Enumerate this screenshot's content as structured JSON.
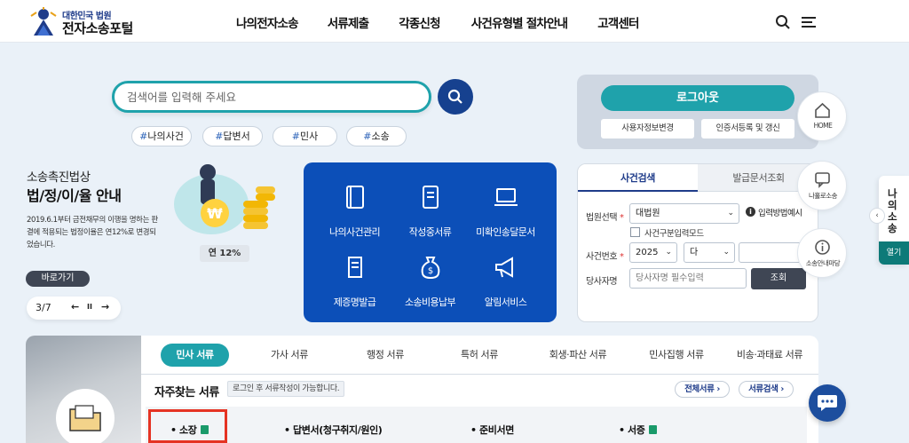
{
  "header": {
    "logo_small": "대한민국 법원",
    "logo_big": "전자소송포털",
    "nav": [
      "나의전자소송",
      "서류제출",
      "각종신청",
      "사건유형별 절차안내",
      "고객센터"
    ]
  },
  "search": {
    "placeholder": "검색어를 입력해 주세요",
    "tags": [
      "나의사건",
      "답변서",
      "민사",
      "소송"
    ],
    "tag_hash": "#"
  },
  "promo": {
    "small_title": "소송촉진법상",
    "big_title": "법/정/이/율 안내",
    "description": "2019.6.1부터 금전채무의 이행을 명하는 판결에 적용되는 법정이율은 연12%로 변경되었습니다.",
    "rate_badge": "연 12%",
    "goto_label": "바로가기",
    "pager": {
      "current": "3/7",
      "prev": "←",
      "pause": "II",
      "next": "→"
    }
  },
  "services": [
    {
      "label": "나의사건관리",
      "icon": "book-icon"
    },
    {
      "label": "작성중서류",
      "icon": "notebook-icon"
    },
    {
      "label": "미확인송달문서",
      "icon": "laptop-icon"
    },
    {
      "label": "제증명발급",
      "icon": "certificate-icon"
    },
    {
      "label": "소송비용납부",
      "icon": "money-bag-icon"
    },
    {
      "label": "알림서비스",
      "icon": "megaphone-icon"
    }
  ],
  "login": {
    "logout_label": "로그아웃",
    "user_info_label": "사용자정보변경",
    "cert_label": "인증서등록 및 갱신"
  },
  "case_search": {
    "tabs": [
      "사건검색",
      "발급문서조회"
    ],
    "court_label": "법원선택",
    "court_value": "대법원",
    "court_help": "입력방법예시",
    "court_division_label": "사건구분입력모드",
    "case_no_label": "사건번호",
    "year_value": "2025",
    "type_value": "다",
    "party_label": "당사자명",
    "party_placeholder": "당사자명 필수입력",
    "search_button": "조회",
    "required_mark": "*"
  },
  "quick_menu": [
    "HOME",
    "나홀로소송",
    "소송안내마당"
  ],
  "side_tab": {
    "title": "나의소송",
    "open_label": "열기",
    "arrow": "‹"
  },
  "documents": {
    "tabs": [
      "민사 서류",
      "가사 서류",
      "행정 서류",
      "특허 서류",
      "회생·파산 서류",
      "민사집행 서류",
      "비송·과태료 서류"
    ],
    "active_tab": 0,
    "freq_title": "자주찾는 서류",
    "freq_note": "로그인 후 서류작성이 가능합니다.",
    "all_docs_button": "전체서류 ›",
    "doc_search_button": "서류검색 ›",
    "items": [
      "• 소장",
      "• 답변서(청구취지/원인)",
      "• 준비서면",
      "• 서증"
    ]
  },
  "colors": {
    "teal": "#1fa2ab",
    "navy": "#16418f",
    "service_blue": "#0c4fb8",
    "highlight_red": "#e53323"
  }
}
